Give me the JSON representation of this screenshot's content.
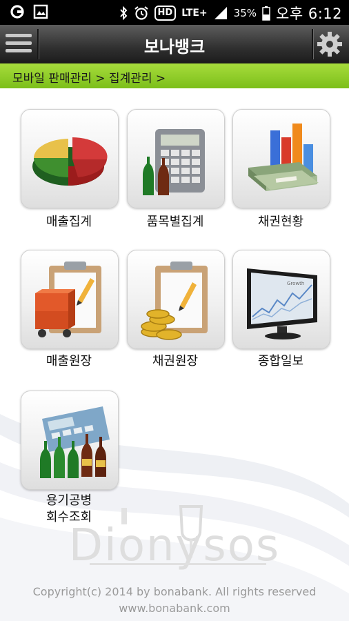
{
  "status_bar": {
    "network": "LTE+",
    "hd": "HD",
    "battery": "35%",
    "time": "오후 6:12"
  },
  "header": {
    "title": "보나뱅크",
    "menu_icon": "hamburger-menu-icon",
    "settings_icon": "gear-icon"
  },
  "breadcrumb": "모바일 판매관리 > 집계관리 >",
  "menu": [
    {
      "label": "매출집계",
      "icon": "pie-chart-icon"
    },
    {
      "label": "품목별집계",
      "icon": "calculator-bottles-icon"
    },
    {
      "label": "채권현황",
      "icon": "money-bar-chart-icon"
    },
    {
      "label": "매출원장",
      "icon": "clipboard-boxes-icon"
    },
    {
      "label": "채권원장",
      "icon": "clipboard-coins-icon"
    },
    {
      "label": "종합일보",
      "icon": "monitor-growth-icon"
    },
    {
      "label_line1": "용기공병",
      "label_line2": "회수조회",
      "icon": "calculator-bottles-icon"
    }
  ],
  "monitor_caption": "Growth",
  "watermark": "Dionysos",
  "footer": {
    "copyright": "Copyright(c) 2014 by bonabank. All rights reserved",
    "website": "www.bonabank.com"
  }
}
